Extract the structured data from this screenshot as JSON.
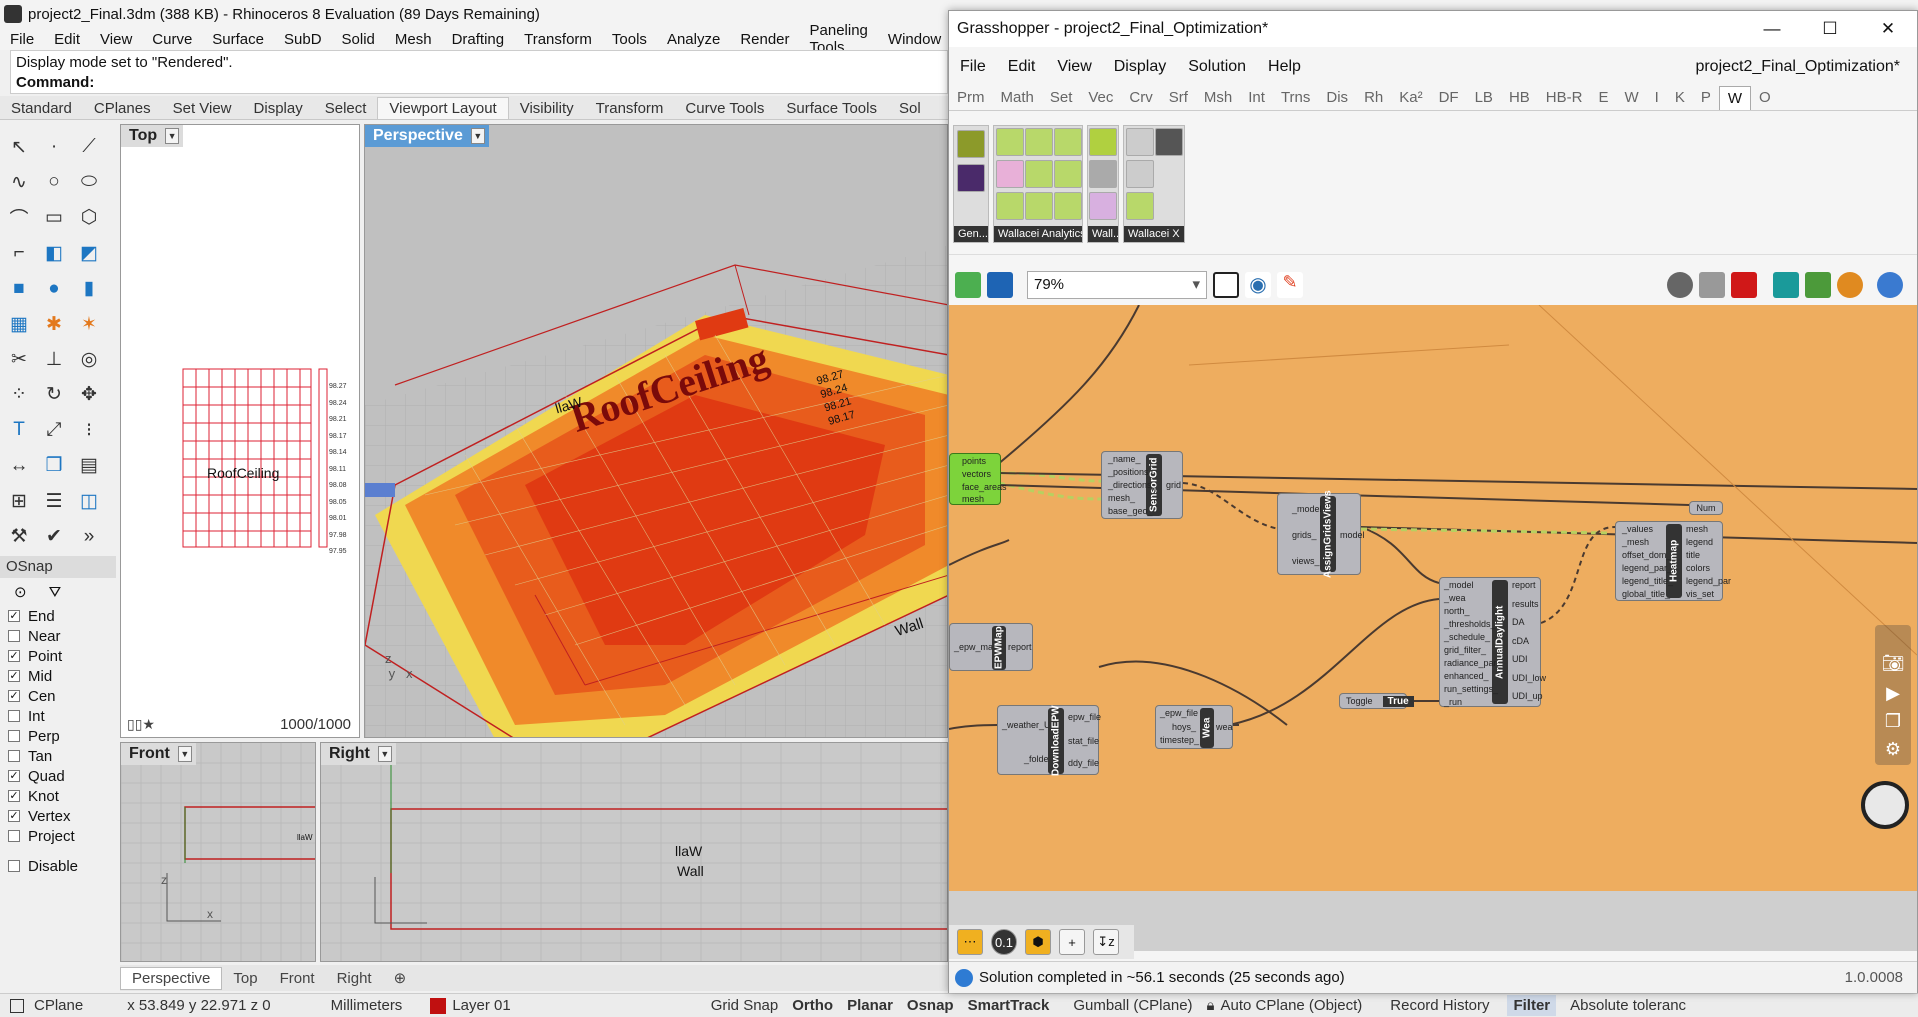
{
  "rhino": {
    "title": "project2_Final.3dm (388 KB) - Rhinoceros 8 Evaluation (89 Days Remaining)",
    "menu": [
      "File",
      "Edit",
      "View",
      "Curve",
      "Surface",
      "SubD",
      "Solid",
      "Mesh",
      "Drafting",
      "Transform",
      "Tools",
      "Analyze",
      "Render",
      "Paneling Tools",
      "Window"
    ],
    "command_history": "Display mode set to \"Rendered\".",
    "command_prompt": "Command:",
    "tabs": [
      "Standard",
      "CPlanes",
      "Set View",
      "Display",
      "Select",
      "Viewport Layout",
      "Visibility",
      "Transform",
      "Curve Tools",
      "Surface Tools",
      "Sol"
    ],
    "active_tab": "Viewport Layout",
    "osnap": {
      "header": "OSnap",
      "items": [
        {
          "label": "End",
          "checked": true
        },
        {
          "label": "Near",
          "checked": false
        },
        {
          "label": "Point",
          "checked": true
        },
        {
          "label": "Mid",
          "checked": true
        },
        {
          "label": "Cen",
          "checked": true
        },
        {
          "label": "Int",
          "checked": false
        },
        {
          "label": "Perp",
          "checked": false
        },
        {
          "label": "Tan",
          "checked": false
        },
        {
          "label": "Quad",
          "checked": true
        },
        {
          "label": "Knot",
          "checked": true
        },
        {
          "label": "Vertex",
          "checked": true
        },
        {
          "label": "Project",
          "checked": false
        }
      ],
      "disable": "Disable"
    },
    "viewports": {
      "top": {
        "label": "Top",
        "counter": "1000/1000",
        "text": "RoofCeiling",
        "values": [
          "98.27",
          "98.24",
          "98.21",
          "98.17",
          "98.14",
          "98.11",
          "98.08",
          "98.05",
          "98.01",
          "97.98",
          "97.95"
        ]
      },
      "perspective": {
        "label": "Perspective",
        "text_roof": "RoofCeiling",
        "text_wall": "Wall",
        "text_wall_mirror": "llaW",
        "values": [
          "98.27",
          "98.24",
          "98.21",
          "98.17"
        ]
      },
      "front": {
        "label": "Front"
      },
      "right": {
        "label": "Right",
        "text1": "llaW",
        "text2": "Wall"
      }
    },
    "viewport_tabs": [
      "Perspective",
      "Top",
      "Front",
      "Right"
    ],
    "status": {
      "cplane": "CPlane",
      "coords": "x 53.849  y 22.971  z 0",
      "units": "Millimeters",
      "layer": "Layer 01",
      "grid_snap": "Grid Snap",
      "ortho": "Ortho",
      "planar": "Planar",
      "osnap": "Osnap",
      "smarttrack": "SmartTrack",
      "gumball": "Gumball (CPlane)",
      "autocplane": "Auto CPlane (Object)",
      "record": "Record History",
      "filter": "Filter",
      "tolerance": "Absolute toleranc"
    }
  },
  "gh": {
    "title": "Grasshopper - project2_Final_Optimization*",
    "menu": [
      "File",
      "Edit",
      "View",
      "Display",
      "Solution",
      "Help"
    ],
    "doc_name": "project2_Final_Optimization*",
    "categories": [
      "Prm",
      "Math",
      "Set",
      "Vec",
      "Crv",
      "Srf",
      "Msh",
      "Int",
      "Trns",
      "Dis",
      "Rh",
      "Ka²",
      "DF",
      "LB",
      "HB",
      "HB-R",
      "E",
      "W",
      "I",
      "K",
      "P",
      "W",
      "O"
    ],
    "ribbon_groups": [
      "Gen...",
      "Wallacei Analytics",
      "Wall...",
      "Wallacei X"
    ],
    "zoom": "79%",
    "components": {
      "sensor": {
        "name": "SensorGrid",
        "inputs": [
          "_name_",
          "_positions",
          "_directions_",
          "mesh_",
          "base_geo_"
        ],
        "outputs": [
          "grid"
        ]
      },
      "assign": {
        "name": "AssignGridsViews",
        "inputs": [
          "_model",
          "grids_",
          "views_"
        ],
        "outputs": [
          "model"
        ]
      },
      "annual": {
        "name": "AnnualDaylight",
        "inputs": [
          "_model",
          "_wea",
          "north_",
          "_thresholds_",
          "_schedule_",
          "grid_filter_",
          "radiance_par_",
          "enhanced_",
          "run_settings_",
          "_run"
        ],
        "outputs": [
          "report",
          "results",
          "DA",
          "cDA",
          "UDI",
          "UDI_low",
          "UDI_up"
        ]
      },
      "heatmap": {
        "name": "Heatmap",
        "inputs": [
          "_values",
          "_mesh",
          "offset_dom_",
          "legend_par_",
          "legend_title_",
          "global_title_"
        ],
        "outputs": [
          "mesh",
          "legend",
          "title",
          "colors",
          "legend_par",
          "vis_set"
        ]
      },
      "epw": {
        "name": "EPWMap",
        "inputs": [
          "_epw_map"
        ],
        "outputs": [
          "report"
        ]
      },
      "download": {
        "name": "DownloadEPW",
        "inputs": [
          "_weather_URL",
          "_folder_"
        ],
        "outputs": [
          "epw_file",
          "stat_file",
          "ddy_file"
        ]
      },
      "wea": {
        "name": "Wea",
        "inputs": [
          "_epw_file",
          "hoys_",
          "timestep_"
        ],
        "outputs": [
          "wea"
        ]
      },
      "green": {
        "outputs": [
          "points",
          "vectors",
          "face_areas",
          "mesh"
        ]
      },
      "toggle": {
        "label": "Toggle",
        "value": "True"
      },
      "num": "Num"
    },
    "status": "Solution completed in ~56.1 seconds (25 seconds ago)",
    "version": "1.0.0008"
  }
}
